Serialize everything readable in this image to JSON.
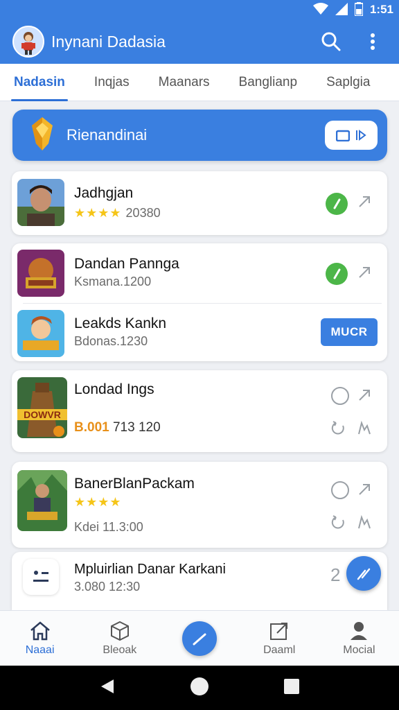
{
  "status_bar": {
    "time": "1:51",
    "icons": [
      "wifi-icon",
      "signal-icon",
      "battery-icon"
    ]
  },
  "app_bar": {
    "title": "Inynani Dadasia",
    "icons": [
      "search-icon",
      "more-vert-icon"
    ]
  },
  "tabs": [
    {
      "label": "Nadasin",
      "active": true
    },
    {
      "label": "Inqjas",
      "active": false
    },
    {
      "label": "Maanars",
      "active": false
    },
    {
      "label": "Banglianp",
      "active": false
    },
    {
      "label": "Saplgia",
      "active": false
    }
  ],
  "banner": {
    "title": "Rienandinai",
    "icon": "trophy-icon"
  },
  "card1": {
    "title": "Jadhgjan",
    "stars": "★★★★",
    "meta": "20380"
  },
  "card2": {
    "row1": {
      "title": "Dandan Pannga",
      "meta": "Ksmana.1200"
    },
    "row2": {
      "title": "Leakds Kankn",
      "meta": "Bdonas.1230",
      "button": "MUCR"
    }
  },
  "card3": {
    "title": "Londad Ings",
    "price": "B.001",
    "meta": "713 120",
    "badge_text": "DOWVR"
  },
  "card4": {
    "title": "BanerBlanPackam",
    "stars": "★★★★",
    "meta": "Kdei 11.3:00"
  },
  "card5": {
    "title": "Mpluirlian Danar Karkani",
    "meta": "3.080 12:30",
    "trailing": "2"
  },
  "bottom_nav": [
    {
      "label": "Naaai",
      "active": true
    },
    {
      "label": "Bleoak",
      "active": false
    },
    {
      "label": "",
      "active": false
    },
    {
      "label": "Daaml",
      "active": false
    },
    {
      "label": "Mocial",
      "active": false
    }
  ],
  "colors": {
    "primary": "#3a7fe0",
    "accent_green": "#4cb648",
    "star": "#f5c518",
    "price": "#e8901a"
  }
}
